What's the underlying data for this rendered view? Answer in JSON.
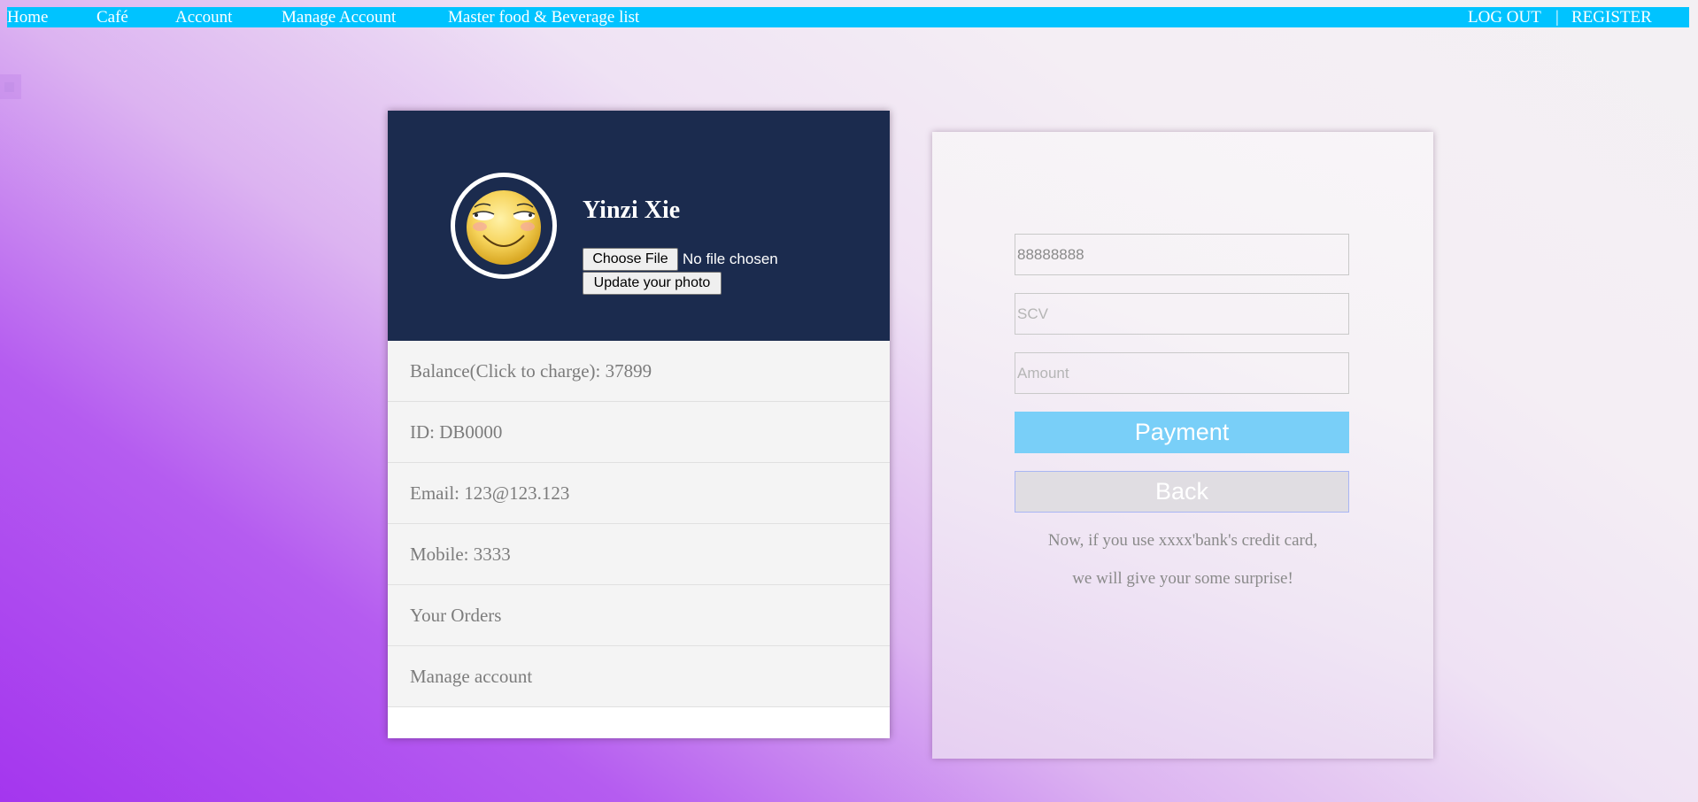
{
  "nav": {
    "home": "Home",
    "cafe": "Café",
    "account": "Account",
    "manage_account": "Manage Account",
    "master_list": "Master food & Beverage list",
    "logout": "LOG OUT",
    "separator": "|",
    "register": "REGISTER"
  },
  "profile": {
    "name": "Yinzi Xie",
    "avatar_icon": "smiley-face-icon",
    "choose_file_label": "Choose File",
    "file_status": "No file chosen",
    "update_photo_label": "Update your photo",
    "items": [
      "Balance(Click to charge): 37899",
      "ID: DB0000",
      "Email: 123@123.123",
      "Mobile: 3333",
      "Your Orders",
      "Manage account"
    ]
  },
  "payment": {
    "card_number_value": "88888888",
    "scv_placeholder": "SCV",
    "amount_placeholder": "Amount",
    "pay_label": "Payment",
    "back_label": "Back",
    "promo_line1": "Now, if you use xxxx'bank's credit card,",
    "promo_line2": "we will give your some surprise!"
  },
  "colors": {
    "navbar": "#00c3ff",
    "profile_header": "#1b2b4e",
    "payment_button": "#79cff8"
  }
}
